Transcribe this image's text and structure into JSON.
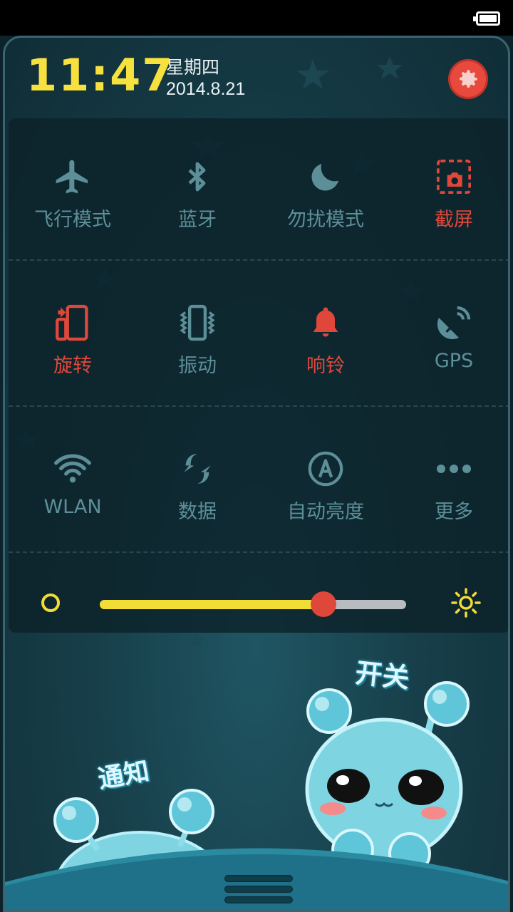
{
  "status_bar": {
    "battery_icon": "battery-full-icon"
  },
  "header": {
    "time": "11:47",
    "weekday": "星期四",
    "date": "2014.8.21",
    "settings_icon": "gear-icon"
  },
  "toggles": [
    {
      "label": "飞行模式",
      "icon": "airplane-icon",
      "active": false
    },
    {
      "label": "蓝牙",
      "icon": "bluetooth-icon",
      "active": false
    },
    {
      "label": "勿扰模式",
      "icon": "moon-icon",
      "active": false
    },
    {
      "label": "截屏",
      "icon": "screenshot-icon",
      "active": true
    },
    {
      "label": "旋转",
      "icon": "rotate-icon",
      "active": true
    },
    {
      "label": "振动",
      "icon": "vibrate-icon",
      "active": false
    },
    {
      "label": "响铃",
      "icon": "bell-icon",
      "active": true
    },
    {
      "label": "GPS",
      "icon": "gps-icon",
      "active": false
    },
    {
      "label": "WLAN",
      "icon": "wifi-icon",
      "active": false
    },
    {
      "label": "数据",
      "icon": "data-icon",
      "active": false
    },
    {
      "label": "自动亮度",
      "icon": "auto-brightness-icon",
      "active": false
    },
    {
      "label": "更多",
      "icon": "more-icon",
      "active": false
    }
  ],
  "brightness": {
    "level": 0.73
  },
  "mascots": {
    "switch_label": "开关",
    "notify_label": "通知"
  },
  "colors": {
    "active": "#e0473b",
    "inactive": "#5d8f98",
    "clock": "#f7e13f",
    "slider_fill": "#f2dc36"
  }
}
